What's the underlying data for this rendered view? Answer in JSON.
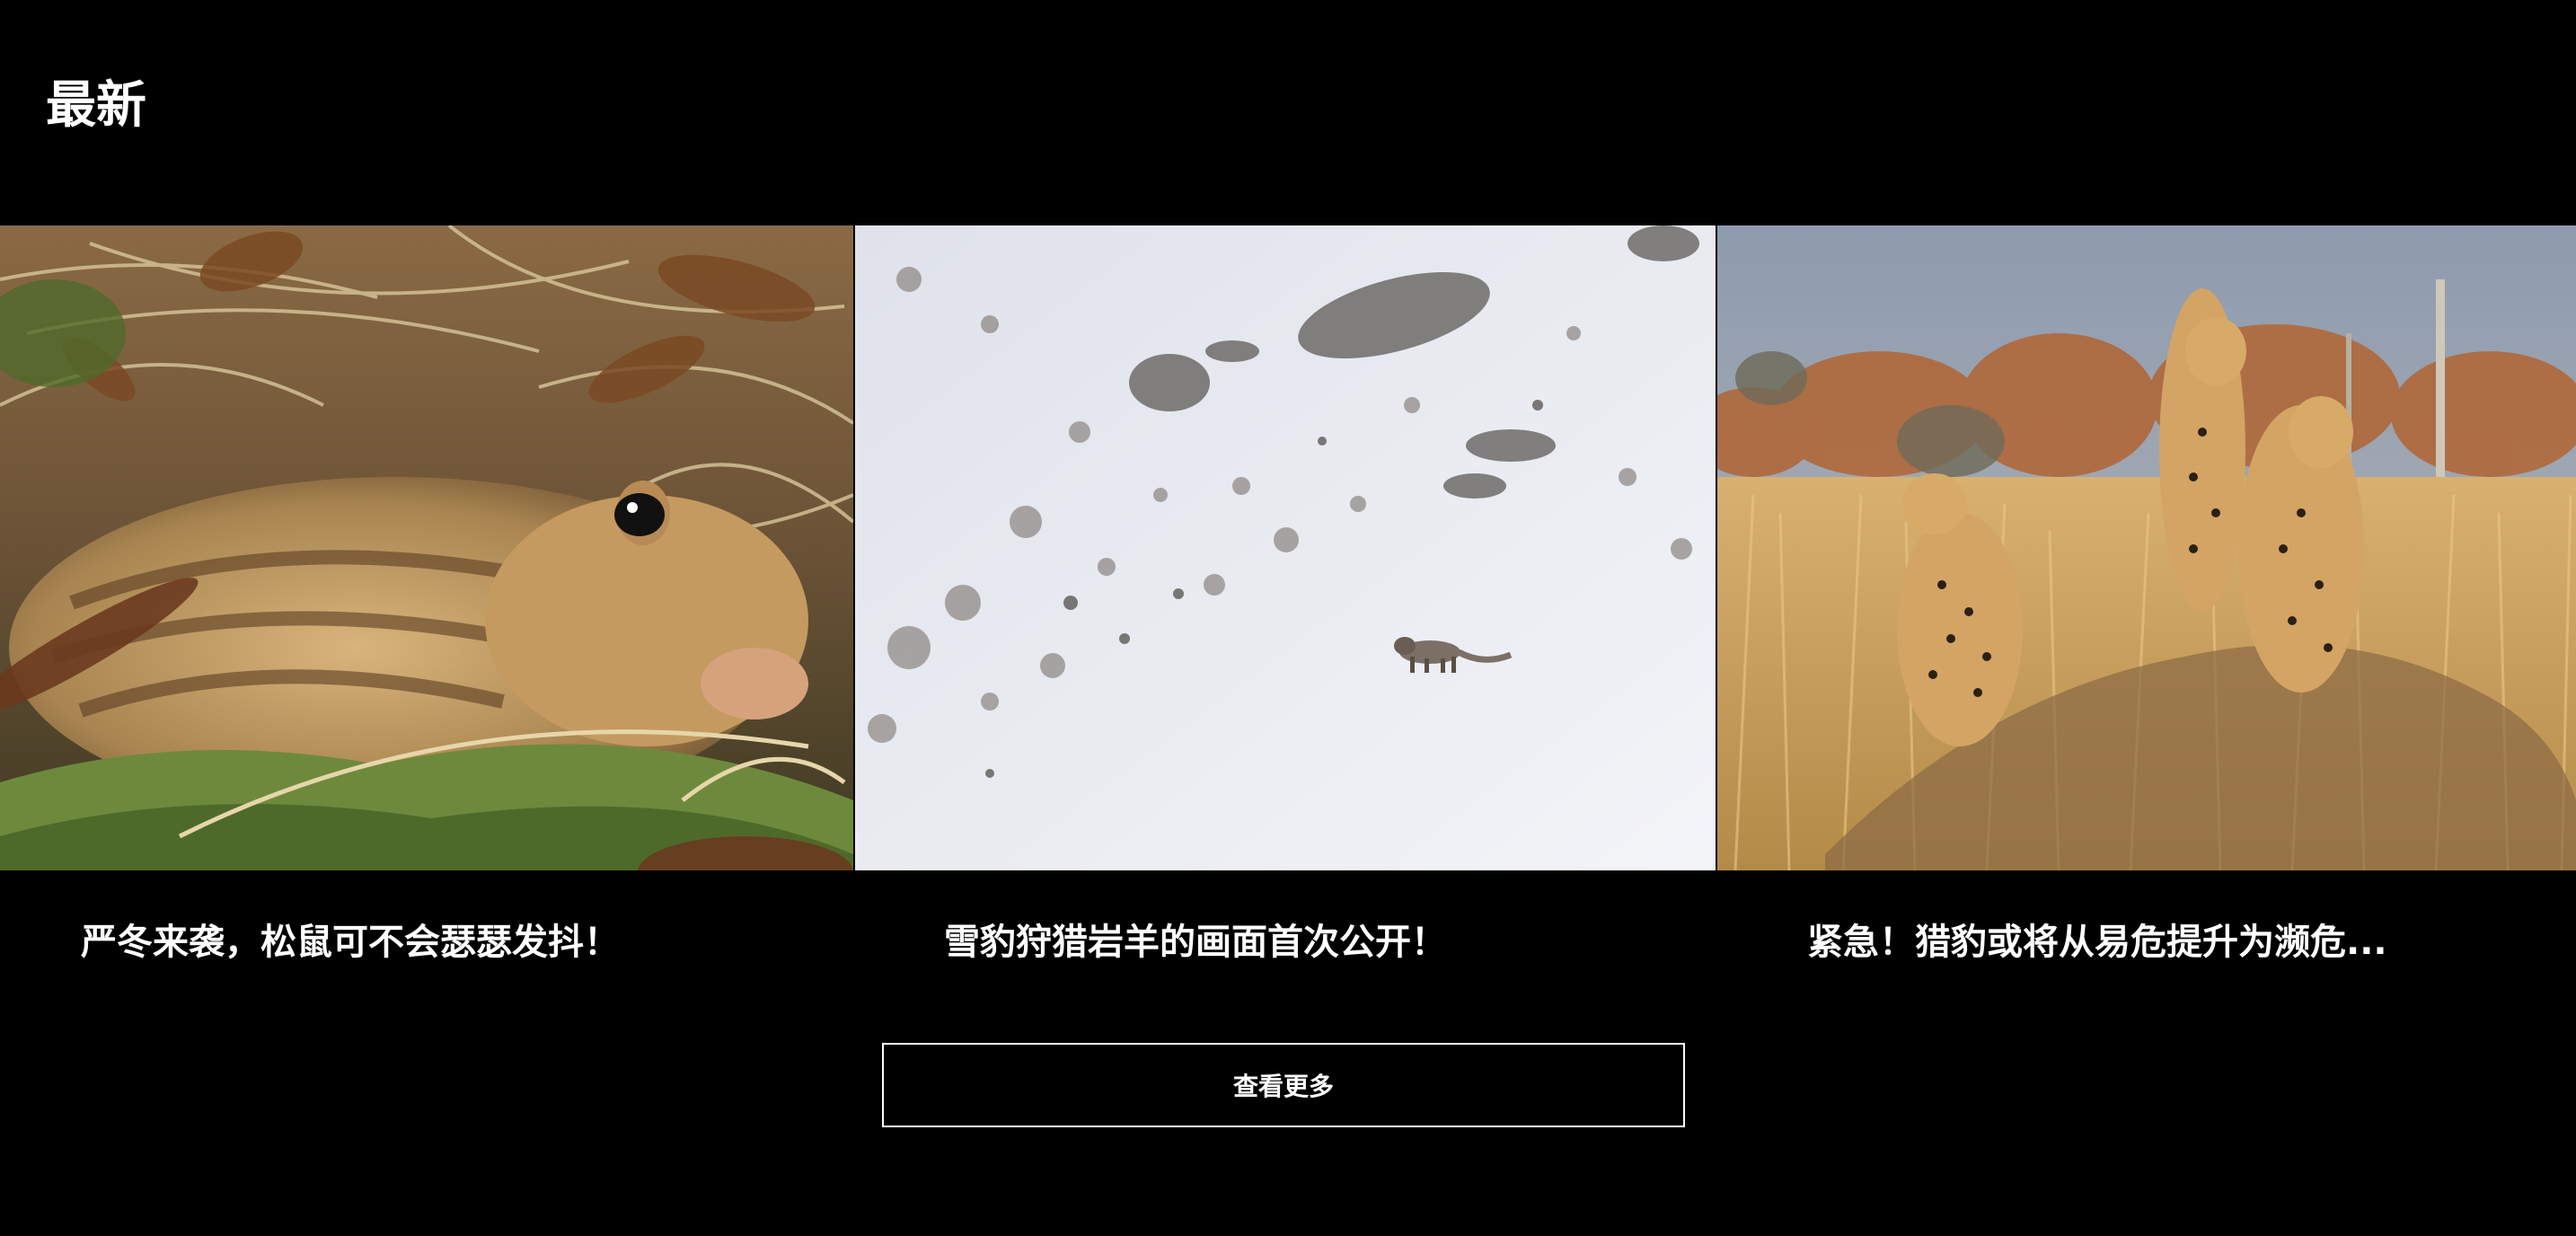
{
  "section": {
    "title": "最新"
  },
  "cards": [
    {
      "title": "严冬来袭，松鼠可不会瑟瑟发抖！",
      "image": "ground-squirrel-in-dry-grass"
    },
    {
      "title": "雪豹狩猎岩羊的画面首次公开！",
      "image": "snow-leopard-on-snowy-slope"
    },
    {
      "title": "紧急！猎豹或将从易危提升为濒危...",
      "image": "three-cheetahs-in-savanna"
    }
  ],
  "more_button": {
    "label": "查看更多"
  },
  "colors": {
    "background": "#000000",
    "text": "#ffffff",
    "button_border": "#ffffff"
  }
}
